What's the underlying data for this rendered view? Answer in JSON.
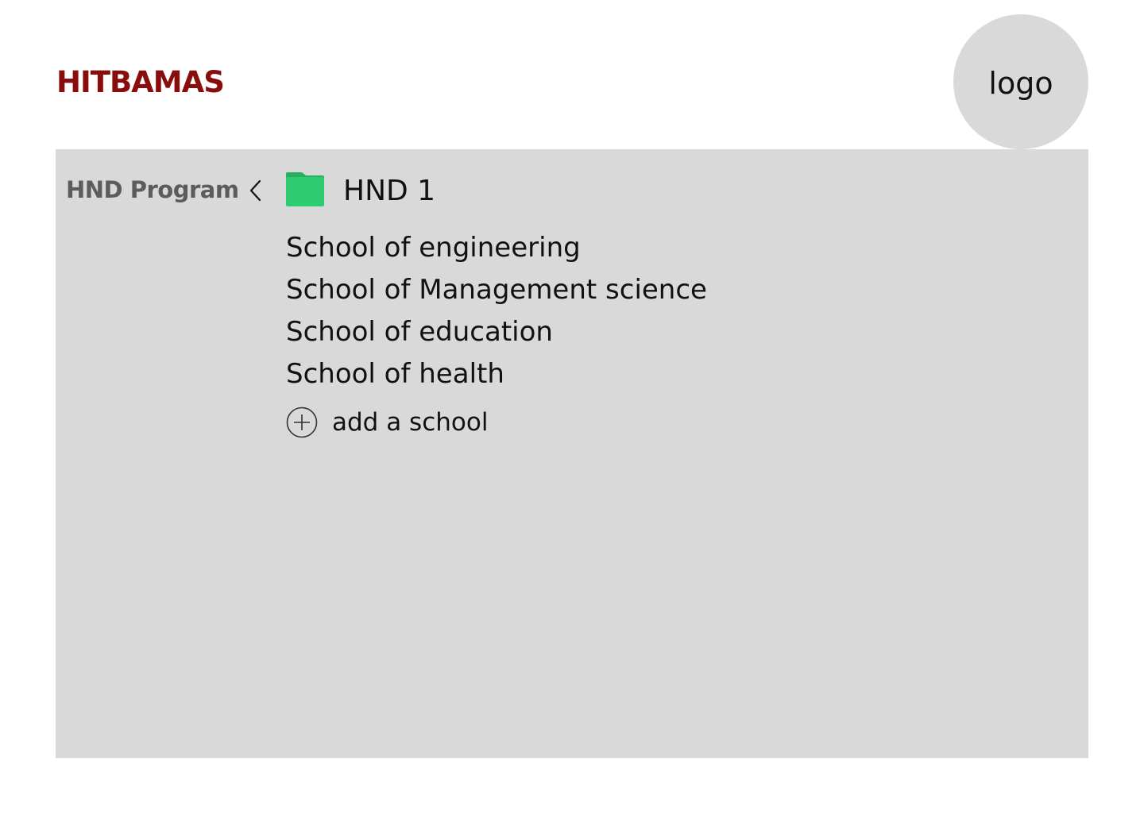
{
  "header": {
    "brand": "HITBAMAS",
    "logo_label": "logo"
  },
  "breadcrumb": {
    "parent": "HND Program",
    "current": "HND 1",
    "back_icon": "chevron-left-icon",
    "folder_icon": "folder-icon"
  },
  "schools": [
    "School of engineering",
    "School of Management science",
    "School of education",
    "School of health"
  ],
  "add_school": {
    "label": "add a school",
    "icon": "plus-circle-icon"
  },
  "colors": {
    "brand": "#8a0d0d",
    "panel": "#d9d9d9",
    "folder": "#2ecc71",
    "folder_tab": "#27ae60",
    "muted_text": "#5c5c5c"
  }
}
